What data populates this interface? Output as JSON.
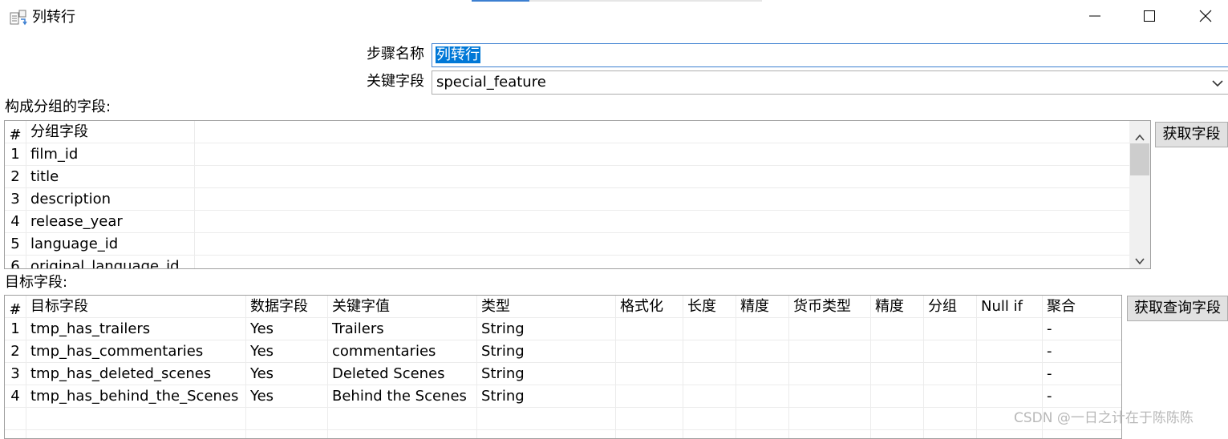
{
  "window": {
    "title": "列转行",
    "icons": {
      "app": "row-normaliser-icon",
      "minimize": "minimize-icon",
      "maximize": "maximize-icon",
      "close": "close-icon"
    }
  },
  "form": {
    "step_name_label": "步骤名称",
    "step_name_value": "列转行",
    "key_field_label": "关键字段",
    "key_field_value": "special_feature"
  },
  "group_section": {
    "label": "构成分组的字段:",
    "headers": [
      "#",
      "分组字段"
    ],
    "rows": [
      [
        "1",
        "film_id"
      ],
      [
        "2",
        "title"
      ],
      [
        "3",
        "description"
      ],
      [
        "4",
        "release_year"
      ],
      [
        "5",
        "language_id"
      ],
      [
        "6",
        "original_language_id"
      ]
    ],
    "get_fields_button": "获取字段"
  },
  "target_section": {
    "label": "目标字段:",
    "headers": [
      "#",
      "目标字段",
      "数据字段",
      "关键字值",
      "类型",
      "格式化",
      "长度",
      "精度",
      "货币类型",
      "精度",
      "分组",
      "Null if",
      "聚合"
    ],
    "rows": [
      [
        "1",
        "tmp_has_trailers",
        "Yes",
        "Trailers",
        "String",
        "",
        "",
        "",
        "",
        "",
        "",
        "",
        "-"
      ],
      [
        "2",
        "tmp_has_commentaries",
        "Yes",
        "commentaries",
        "String",
        "",
        "",
        "",
        "",
        "",
        "",
        "",
        "-"
      ],
      [
        "3",
        "tmp_has_deleted_scenes",
        "Yes",
        "Deleted Scenes",
        "String",
        "",
        "",
        "",
        "",
        "",
        "",
        "",
        "-"
      ],
      [
        "4",
        "tmp_has_behind_the_Scenes",
        "Yes",
        "Behind the Scenes",
        "String",
        "",
        "",
        "",
        "",
        "",
        "",
        "",
        "-"
      ]
    ],
    "get_lookup_fields_button": "获取查询字段"
  },
  "watermark": "CSDN @一日之计在于陈陈陈",
  "colors": {
    "selection": "#0078d7",
    "focus_border": "#3c7fd1",
    "button_bg": "#e1e1e1"
  }
}
